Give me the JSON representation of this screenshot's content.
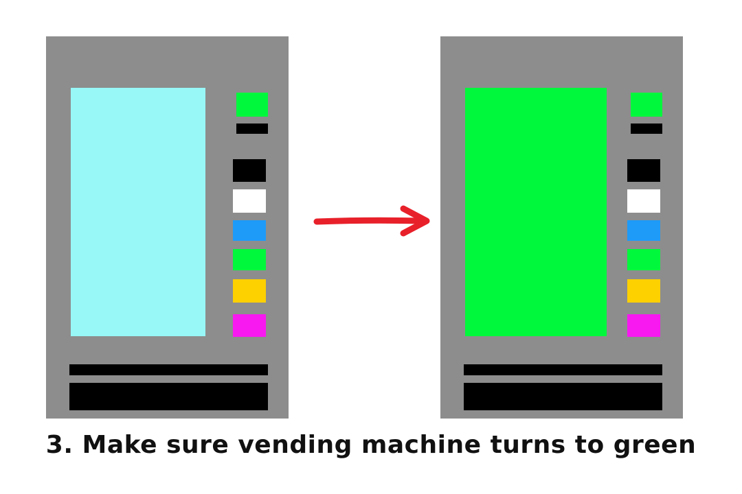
{
  "caption": "3. Make sure vending machine turns to green",
  "colors": {
    "machine_body": "#8d8d8d",
    "screen_before": "#98f8f8",
    "screen_after": "#00f83c",
    "indicator": "#00f83c",
    "arrow": "#e8202a",
    "buttons": [
      "#000000",
      "#ffffff",
      "#1e9bf8",
      "#00f83c",
      "#fdd000",
      "#f818f0"
    ]
  },
  "machines": [
    {
      "state": "before",
      "screen_color": "#98f8f8"
    },
    {
      "state": "after",
      "screen_color": "#00f83c"
    }
  ]
}
